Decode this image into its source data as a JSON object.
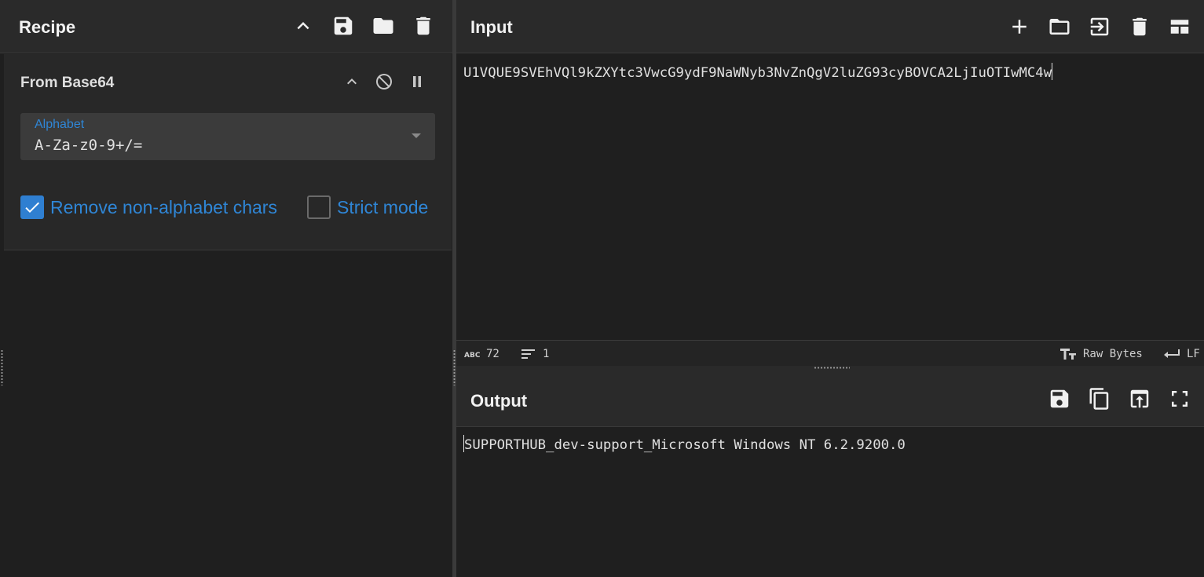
{
  "recipe": {
    "title": "Recipe",
    "header_icons": [
      "chevron-up-icon",
      "save-icon",
      "folder-icon",
      "trash-icon"
    ],
    "operation": {
      "name": "From Base64",
      "icons": [
        "chevron-up-icon",
        "disable-icon",
        "pause-icon"
      ],
      "alphabet": {
        "label": "Alphabet",
        "value": "A-Za-z0-9+/="
      },
      "remove_non_alphabet": {
        "label": "Remove non-alphabet chars",
        "checked": true
      },
      "strict_mode": {
        "label": "Strict mode",
        "checked": false
      }
    }
  },
  "input": {
    "title": "Input",
    "header_icons": [
      "plus-icon",
      "folder-icon",
      "import-icon",
      "trash-icon",
      "layout-icon"
    ],
    "text": "U1VQUE9SVEhVQl9kZXYtc3VwcG9ydF9NaWNyb3NvZnQgV2luZG93cyBOVCA2LjIuOTIwMC4w",
    "status": {
      "char_count": "72",
      "line_count": "1",
      "encoding": "Raw Bytes",
      "eol": "LF"
    }
  },
  "output": {
    "title": "Output",
    "header_icons": [
      "save-icon",
      "copy-icon",
      "replace-input-icon",
      "fullscreen-icon"
    ],
    "text": "SUPPORTHUB_dev-support_Microsoft Windows NT 6.2.9200.0"
  },
  "colors": {
    "accent": "#2f86d6",
    "background": "#1f1f1f",
    "header": "#2a2a2a"
  }
}
